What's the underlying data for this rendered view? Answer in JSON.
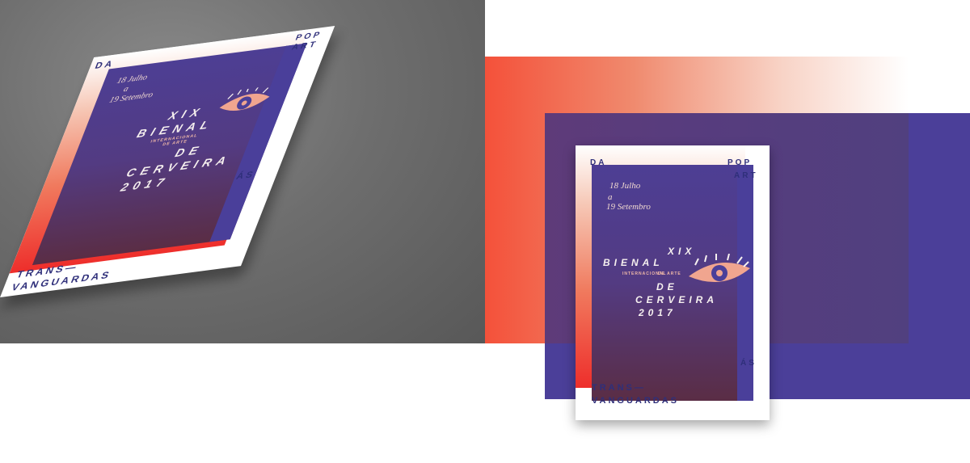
{
  "poster": {
    "top_left": "DA",
    "top_right_1": "POP",
    "top_right_2": "ART",
    "dates_line1": "18 Julho",
    "dates_line2": "a",
    "dates_line3": "19 Setembro",
    "roman": "XIX",
    "bienal": "BIENAL",
    "subtitle_1": "INTERNACIONAL",
    "subtitle_2": "DE ARTE",
    "de": "DE",
    "city": "CERVEIRA",
    "year": "2017",
    "side_word": "ÁS",
    "bottom_1": "TRANS—",
    "bottom_2": "VANGUARDAS"
  },
  "colors": {
    "accent_red": "#ee2e2b",
    "salmon": "#f08a6e",
    "purple": "#4b3f99",
    "eye": "#f0a58f"
  }
}
